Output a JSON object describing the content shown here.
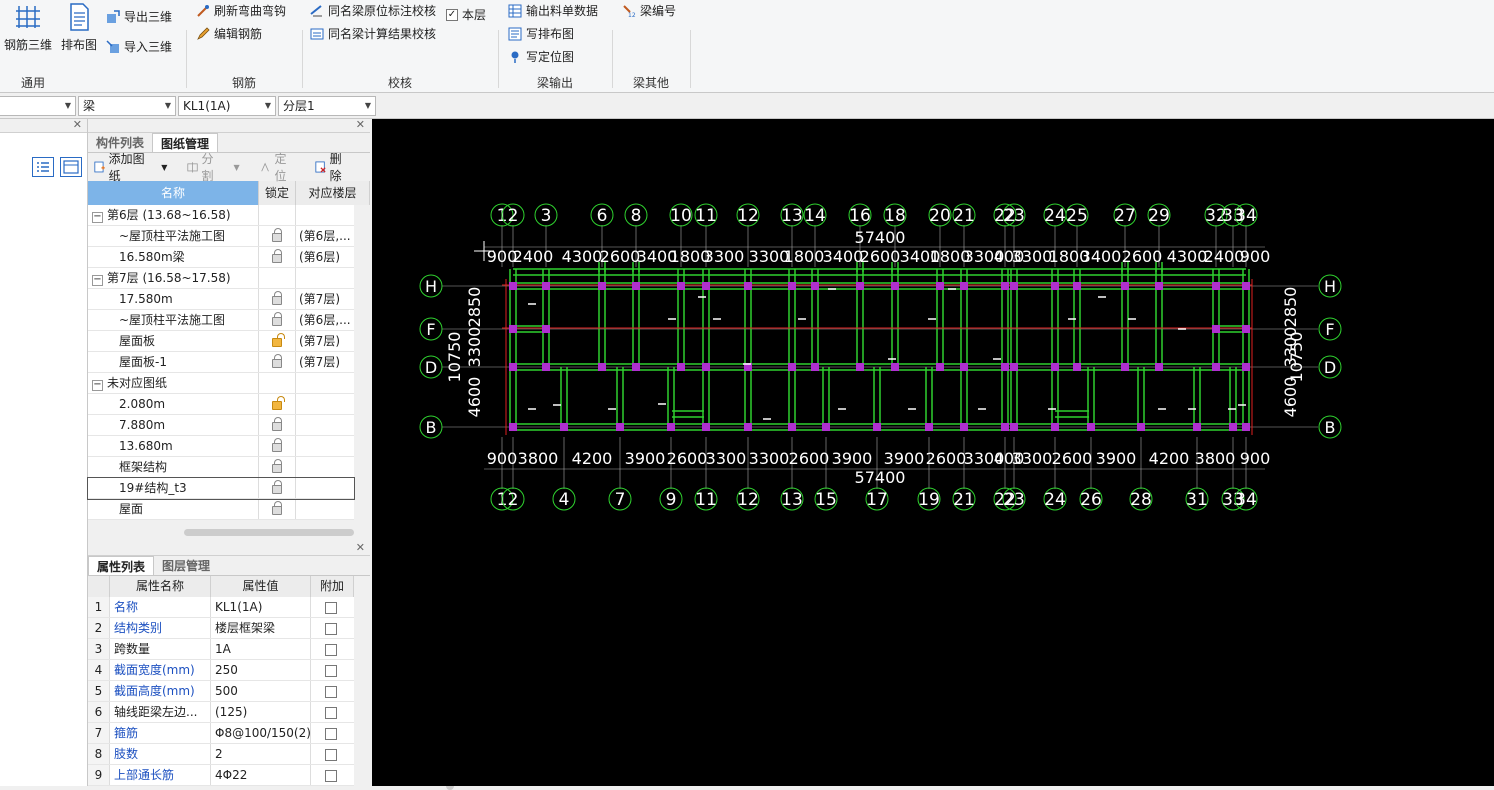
{
  "ribbon": {
    "groups": [
      {
        "label": "通用"
      },
      {
        "label": "钢筋"
      },
      {
        "label": "校核"
      },
      {
        "label": "梁输出"
      },
      {
        "label": "梁其他"
      }
    ],
    "big_buttons": {
      "rebar3d": "钢筋三维",
      "layout": "排布图"
    },
    "export3d": "导出三维",
    "import3d": "导入三维",
    "refresh_bend": "刷新弯曲弯钩",
    "edit_rebar": "编辑钢筋",
    "check_annotation": "同名梁原位标注校核",
    "this_floor": "本层",
    "check_calc": "同名梁计算结果校核",
    "export_bom": "输出料单数据",
    "write_layout": "写排布图",
    "write_position": "写定位图",
    "beam_number": "梁编号"
  },
  "combos": [
    {
      "value": ""
    },
    {
      "value": "梁"
    },
    {
      "value": "KL1(1A)"
    },
    {
      "value": "分层1"
    }
  ],
  "drawings_panel": {
    "tabs": [
      "构件列表",
      "图纸管理"
    ],
    "toolbar": {
      "add": "添加图纸",
      "split": "分割",
      "locate": "定位",
      "delete": "删除"
    },
    "headers": [
      "名称",
      "锁定",
      "对应楼层"
    ],
    "rows": [
      {
        "name": "第6层 (13.68~16.58)",
        "group": true,
        "lock": "",
        "floor": ""
      },
      {
        "name": "~屋顶柱平法施工图",
        "group": false,
        "lock": "locked",
        "floor": "(第6层,..."
      },
      {
        "name": "16.580m梁",
        "group": false,
        "lock": "locked",
        "floor": "(第6层)"
      },
      {
        "name": "第7层 (16.58~17.58)",
        "group": true,
        "lock": "",
        "floor": ""
      },
      {
        "name": "17.580m",
        "group": false,
        "lock": "locked",
        "floor": "(第7层)"
      },
      {
        "name": "~屋顶柱平法施工图",
        "group": false,
        "lock": "locked",
        "floor": "(第6层,..."
      },
      {
        "name": "屋面板",
        "group": false,
        "lock": "open",
        "floor": "(第7层)"
      },
      {
        "name": "屋面板-1",
        "group": false,
        "lock": "locked",
        "floor": "(第7层)"
      },
      {
        "name": "未对应图纸",
        "group": true,
        "lock": "",
        "floor": ""
      },
      {
        "name": "2.080m",
        "group": false,
        "lock": "open",
        "floor": ""
      },
      {
        "name": "7.880m",
        "group": false,
        "lock": "locked",
        "floor": ""
      },
      {
        "name": "13.680m",
        "group": false,
        "lock": "locked",
        "floor": ""
      },
      {
        "name": "框架结构",
        "group": false,
        "lock": "locked",
        "floor": ""
      },
      {
        "name": "19#结构_t3",
        "group": false,
        "lock": "locked",
        "floor": ""
      },
      {
        "name": "屋面",
        "group": false,
        "lock": "locked",
        "floor": ""
      }
    ]
  },
  "props_panel": {
    "tabs": [
      "属性列表",
      "图层管理"
    ],
    "headers": [
      "属性名称",
      "属性值",
      "附加"
    ],
    "rows": [
      {
        "n": "1",
        "name": "名称",
        "value": "KL1(1A)",
        "blue": true
      },
      {
        "n": "2",
        "name": "结构类别",
        "value": "楼层框架梁",
        "blue": true
      },
      {
        "n": "3",
        "name": "跨数量",
        "value": "1A",
        "blue": false
      },
      {
        "n": "4",
        "name": "截面宽度(mm)",
        "value": "250",
        "blue": true
      },
      {
        "n": "5",
        "name": "截面高度(mm)",
        "value": "500",
        "blue": true
      },
      {
        "n": "6",
        "name": "轴线距梁左边...",
        "value": "(125)",
        "blue": false
      },
      {
        "n": "7",
        "name": "箍筋",
        "value": "Φ8@100/150(2)",
        "blue": true
      },
      {
        "n": "8",
        "name": "肢数",
        "value": "2",
        "blue": true
      },
      {
        "n": "9",
        "name": "上部通长筋",
        "value": "4Φ22",
        "blue": true
      }
    ]
  },
  "cad": {
    "top_axes": [
      "1",
      "2",
      "3",
      "6",
      "8",
      "10",
      "11",
      "12",
      "13",
      "14",
      "16",
      "18",
      "20",
      "21",
      "22",
      "23",
      "24",
      "25",
      "27",
      "29",
      "32",
      "33",
      "34"
    ],
    "bottom_axes": [
      "1",
      "2",
      "4",
      "7",
      "9",
      "11",
      "12",
      "13",
      "15",
      "17",
      "19",
      "21",
      "22",
      "23",
      "24",
      "26",
      "28",
      "31",
      "33",
      "34"
    ],
    "row_axes": [
      "H",
      "F",
      "D",
      "B"
    ],
    "top_total": "57400",
    "bottom_total": "57400",
    "top_dims": [
      "900",
      "2400",
      "4300",
      "2600",
      "3400",
      "1800",
      "3300",
      "3300",
      "1800",
      "3400",
      "2600",
      "3400",
      "1800",
      "3300",
      "400",
      "3300",
      "1800",
      "3400",
      "2600",
      "4300",
      "2400",
      "900"
    ],
    "bottom_dims": [
      "900",
      "3800",
      "4200",
      "3900",
      "2600",
      "3300",
      "3300",
      "2600",
      "3900",
      "3900",
      "2600",
      "3300",
      "400",
      "3300",
      "2600",
      "3900",
      "4200",
      "3800",
      "900"
    ],
    "left_dims": [
      "10750",
      "2850",
      "3300",
      "4600"
    ],
    "right_dims": [
      "10750",
      "2850",
      "3300",
      "4600"
    ],
    "colors": {
      "beam": "#2fd12f",
      "axis": "#ffffff",
      "column": "#b030d0",
      "redline": "#e02020",
      "background": "#000000"
    }
  }
}
